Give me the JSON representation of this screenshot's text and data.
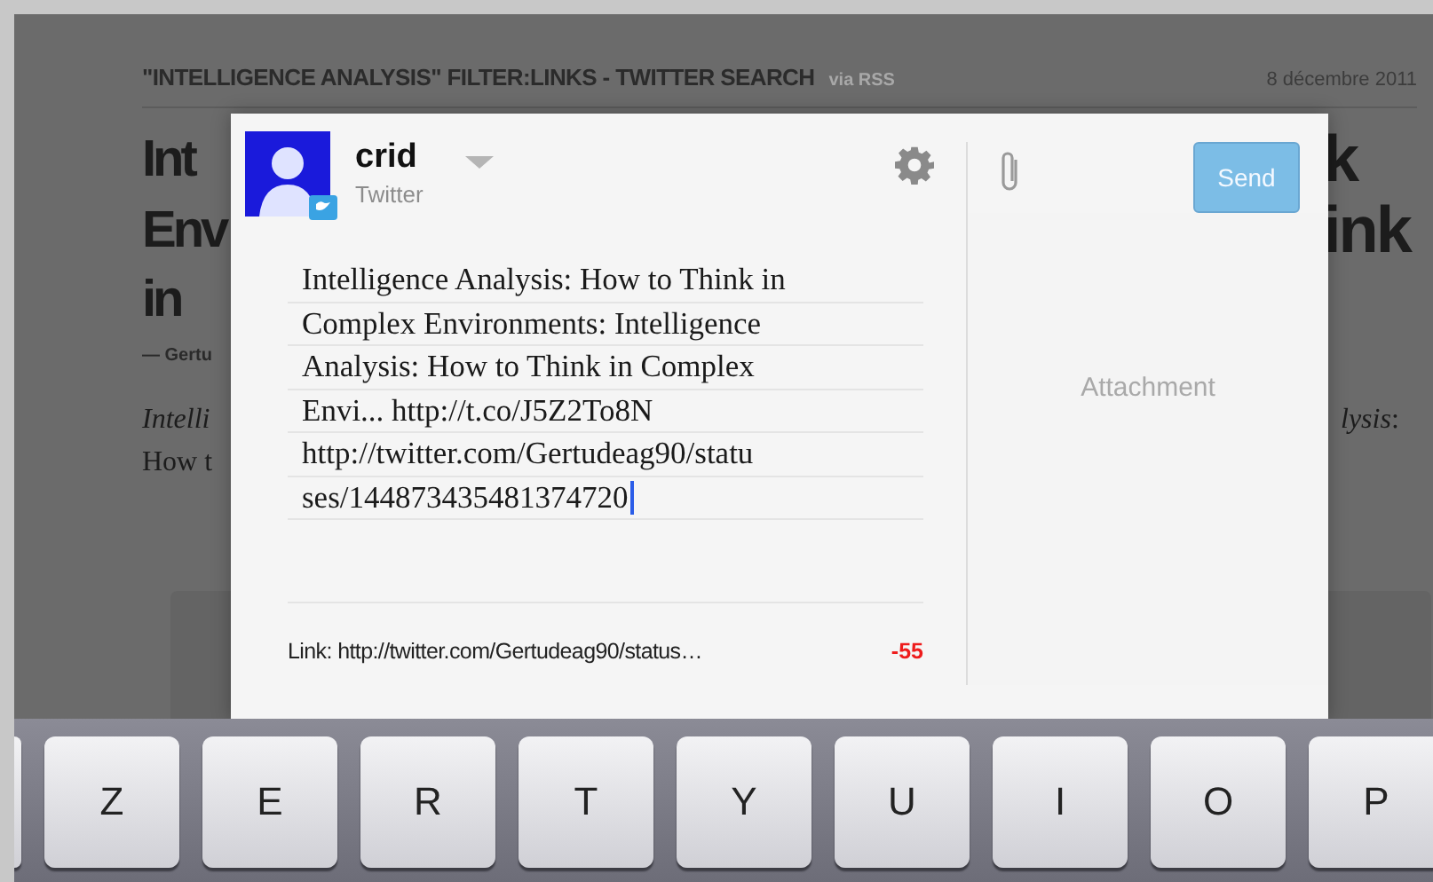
{
  "article": {
    "source": "\"INTELLIGENCE ANALYSIS\" FILTER:LINKS - TWITTER SEARCH",
    "via": "via RSS",
    "date": "8 décembre 2011",
    "title_lines": [
      {
        "left": "Int",
        "right": "k"
      },
      {
        "left": "Env",
        "right": "ink"
      },
      {
        "left": "in"
      }
    ],
    "byline": "— Gertu",
    "body_lines": [
      {
        "left": "*Intelli*",
        "right": "*lysis*:"
      },
      {
        "left": "How t"
      }
    ]
  },
  "composer": {
    "account": {
      "name": "crid",
      "service": "Twitter"
    },
    "text_lines": [
      "Intelligence Analysis: How to Think in",
      "Complex Environments: Intelligence",
      "Analysis: How to Think in Complex",
      "Envi... http://t.co/J5Z2To8N",
      "http://twitter.com/Gertudeag90/statu",
      "ses/144873435481374720"
    ],
    "link": "Link: http://twitter.com/Gertudeag90/status…",
    "count": "-55",
    "attachment_label": "Attachment",
    "send_button": "Send"
  },
  "keyboard": {
    "keys": [
      "Z",
      "E",
      "R",
      "T",
      "Y",
      "U",
      "I",
      "O",
      "P"
    ]
  }
}
